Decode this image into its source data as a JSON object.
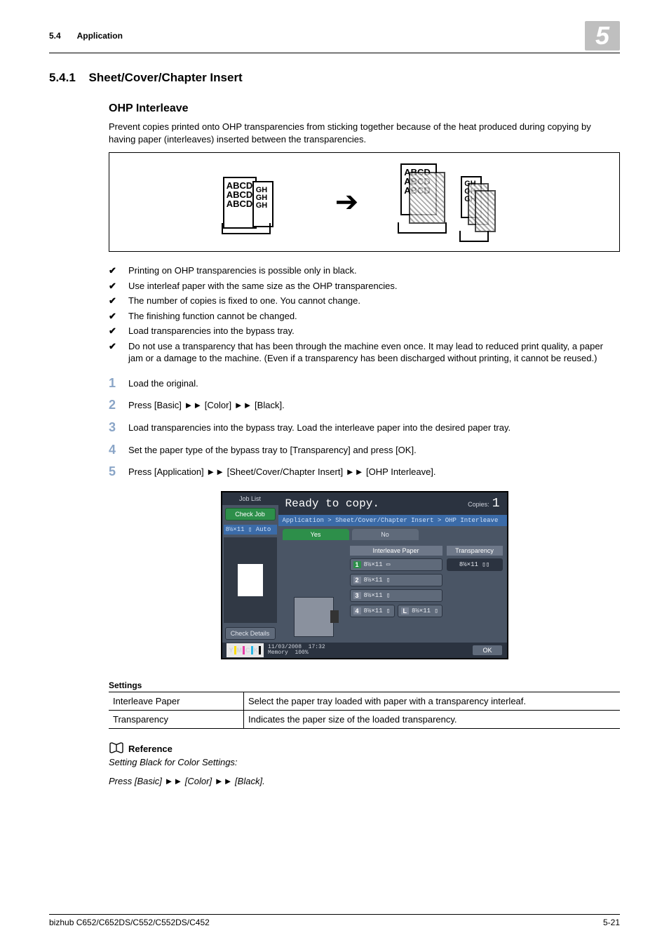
{
  "header": {
    "section_number": "5.4",
    "section_name": "Application",
    "chapter_badge": "5"
  },
  "section": {
    "number": "5.4.1",
    "title": "Sheet/Cover/Chapter Insert"
  },
  "subsection": {
    "title": "OHP Interleave",
    "intro": "Prevent copies printed onto OHP transparencies from sticking together because of the heat produced during copying by having paper (interleaves) inserted between the transparencies."
  },
  "figure1": {
    "sheet_text": "ABCD",
    "sheet_side": "GH"
  },
  "checks": [
    "Printing on OHP transparencies is possible only in black.",
    "Use interleaf paper with the same size as the OHP transparencies.",
    "The number of copies is fixed to one. You cannot change.",
    "The finishing function cannot be changed.",
    "Load transparencies into the bypass tray.",
    "Do not use a transparency that has been through the machine even once. It may lead to reduced print quality, a paper jam or a damage to the machine. (Even if a transparency has been discharged without printing, it cannot be reused.)"
  ],
  "steps": [
    "Load the original.",
    "Press [Basic] ►► [Color] ►► [Black].",
    "Load transparencies into the bypass tray. Load the interleave paper into the desired paper tray.",
    "Set the paper type of the bypass tray to [Transparency] and press [OK].",
    "Press [Application] ►► [Sheet/Cover/Chapter Insert] ►► [OHP Interleave]."
  ],
  "copier": {
    "joblist": "Job List",
    "checkjob": "Check Job",
    "checkdetails": "Check Details",
    "auto_line": "8½×11 ▯  Auto",
    "ready": "Ready to copy.",
    "copies_label": "Copies:",
    "copies_value": "1",
    "breadcrumb": "Application > Sheet/Cover/Chapter Insert > OHP Interleave",
    "tab_yes": "Yes",
    "tab_no": "No",
    "interleave_label": "Interleave Paper",
    "transparency_label": "Transparency",
    "transparency_size": "8½×11 ▯▯",
    "tray1": "8½×11 ▭",
    "tray2": "8½×11 ▯",
    "tray3": "8½×11 ▯",
    "tray4a": "8½×11 ▯",
    "tray4b": "8½×11 ▯",
    "date": "11/03/2008",
    "time": "17:32",
    "mem_label": "Memory",
    "mem_value": "100%",
    "ok": "OK",
    "y": "Y",
    "m": "M",
    "c": "C",
    "k": "K"
  },
  "settings": {
    "title": "Settings",
    "rows": [
      {
        "name": "Interleave Paper",
        "desc": "Select the paper tray loaded with paper with a transparency interleaf."
      },
      {
        "name": "Transparency",
        "desc": "Indicates the paper size of the loaded transparency."
      }
    ]
  },
  "reference": {
    "title": "Reference",
    "line1": "Setting Black for Color Settings:",
    "line2": "Press [Basic] ►► [Color] ►► [Black]."
  },
  "footer": {
    "product": "bizhub C652/C652DS/C552/C552DS/C452",
    "page": "5-21"
  }
}
